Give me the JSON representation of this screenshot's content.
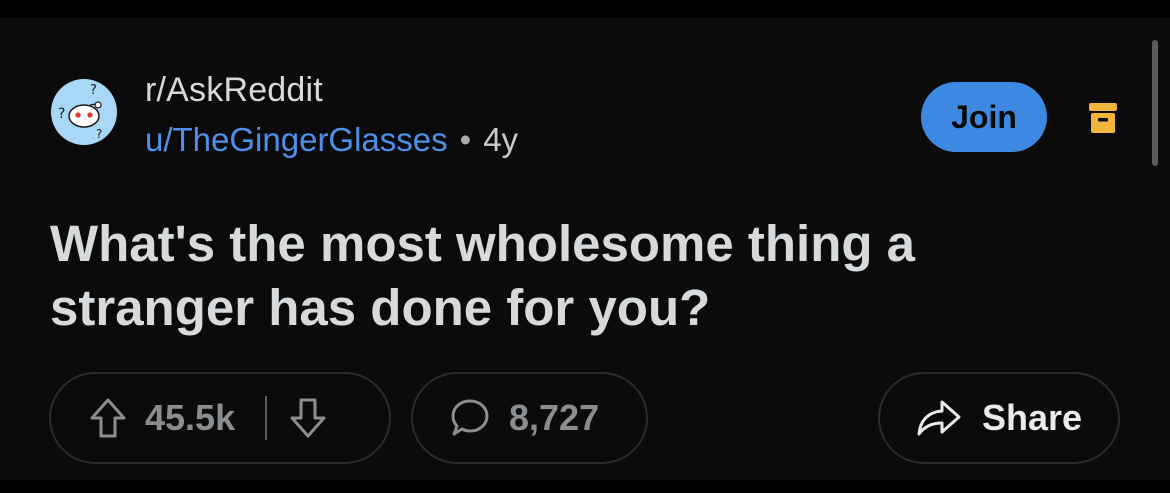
{
  "post": {
    "subreddit": "r/AskReddit",
    "username": "u/TheGingerGlasses",
    "separator": "•",
    "age": "4y",
    "title": "What's the most wholesome thing a stranger has done for you?"
  },
  "actions": {
    "join_label": "Join",
    "upvote_count": "45.5k",
    "comment_count": "8,727",
    "share_label": "Share"
  },
  "icons": {
    "subreddit_avatar": "askreddit-snoo-icon",
    "archive": "archive-icon",
    "upvote": "arrow-up-icon",
    "downvote": "arrow-down-icon",
    "comment": "comment-bubble-icon",
    "share": "share-arrow-icon"
  },
  "colors": {
    "background": "#0b0b0b",
    "text": "#d7dadc",
    "username": "#4f8fea",
    "join_button": "#3d88e0",
    "archive_icon": "#f0b53a",
    "muted": "#8b8e91"
  }
}
